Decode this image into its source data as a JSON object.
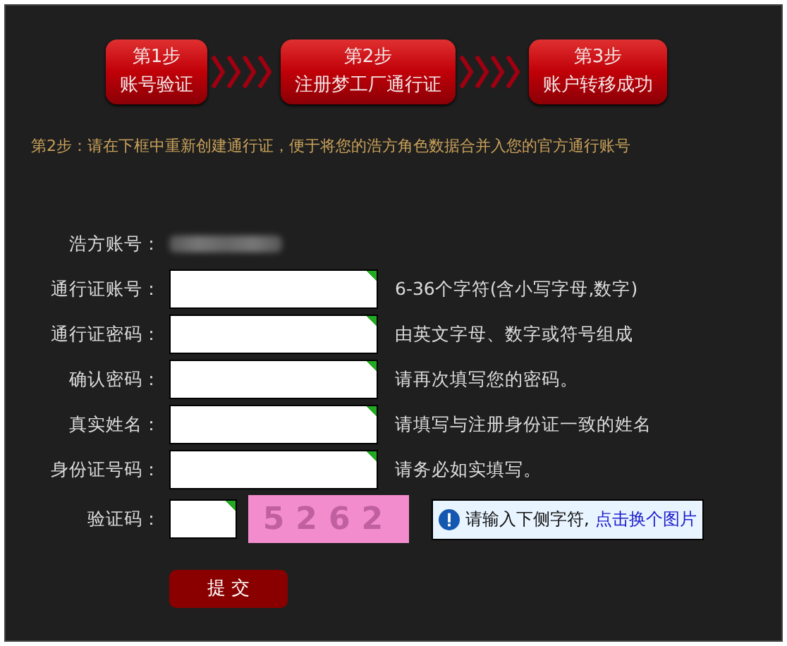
{
  "steps": [
    {
      "number": "第1步",
      "label": "账号验证"
    },
    {
      "number": "第2步",
      "label": "注册梦工厂通行证"
    },
    {
      "number": "第3步",
      "label": "账户转移成功"
    }
  ],
  "instruction": "第2步：请在下框中重新创建通行证，便于将您的浩方角色数据合并入您的官方通行账号",
  "account": {
    "label": "浩方账号："
  },
  "fields": [
    {
      "label": "通行证账号：",
      "hint": "6-36个字符(含小写字母,数字)"
    },
    {
      "label": "通行证密码：",
      "hint": "由英文字母、数字或符号组成"
    },
    {
      "label": "确认密码：",
      "hint": "请再次填写您的密码。"
    },
    {
      "label": "真实姓名：",
      "hint": "请填写与注册身份证一致的姓名"
    },
    {
      "label": "身份证号码：",
      "hint": "请务必如实填写。"
    }
  ],
  "captcha": {
    "label": "验证码：",
    "code": "5262",
    "tip": "请输入下侧字符,",
    "link": "点击换个图片"
  },
  "submit": "提 交"
}
